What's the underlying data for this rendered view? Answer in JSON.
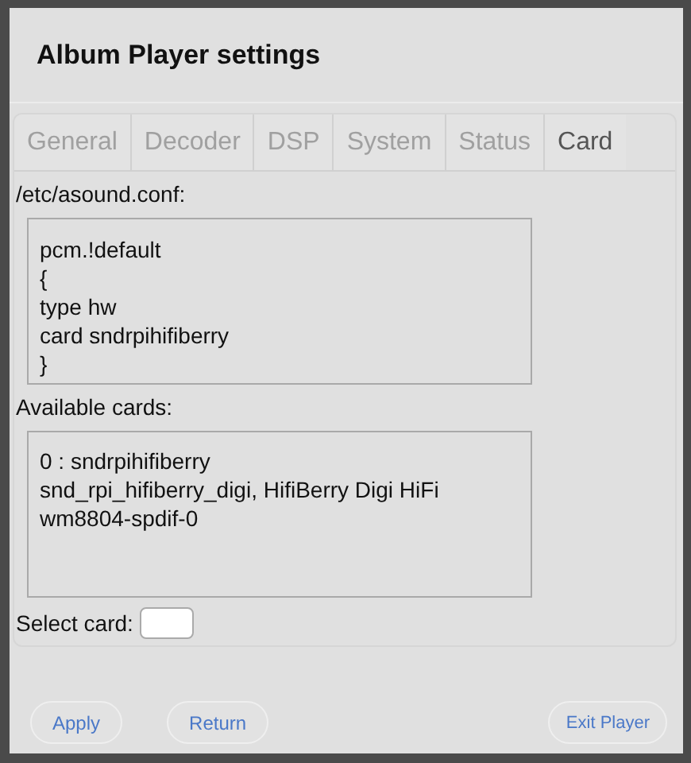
{
  "window": {
    "title": "Album Player settings"
  },
  "tabs": [
    {
      "label": "General",
      "selected": false
    },
    {
      "label": "Decoder",
      "selected": false
    },
    {
      "label": "DSP",
      "selected": false
    },
    {
      "label": "System",
      "selected": false
    },
    {
      "label": "Status",
      "selected": false
    },
    {
      "label": "Card",
      "selected": true
    }
  ],
  "config": {
    "label": "/etc/asound.conf:",
    "lines": [
      "pcm.!default",
      "{",
      "type hw",
      "card sndrpihifiberry",
      "}"
    ]
  },
  "cards": {
    "label": "Available cards:",
    "lines": [
      "0 : sndrpihifiberry",
      "snd_rpi_hifiberry_digi, HifiBerry Digi HiFi",
      "wm8804-spdif-0"
    ]
  },
  "select_card": {
    "label": "Select card:"
  },
  "buttons": {
    "apply": "Apply",
    "return": "Return",
    "exit": "Exit Player"
  }
}
